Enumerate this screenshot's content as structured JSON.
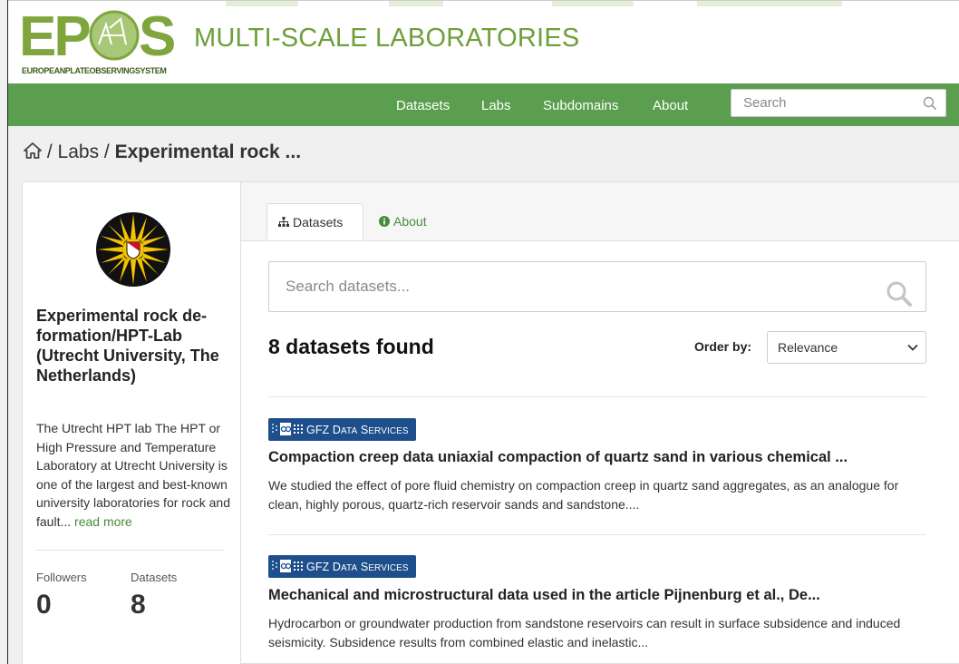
{
  "header": {
    "logo_word": "EPOS",
    "logo_tagline": "EUROPEANPLATEOBSERVINGSYSTEM",
    "site_title": "MULTI-SCALE LABORATORIES",
    "colors": {
      "brand_green": "#5c9e4f",
      "title_green": "#6f9e3a",
      "link_green": "#4a8a3b"
    }
  },
  "nav": {
    "items": [
      {
        "label": "Datasets"
      },
      {
        "label": "Labs"
      },
      {
        "label": "Subdomains"
      },
      {
        "label": "About"
      }
    ],
    "search": {
      "placeholder": "Search",
      "icon": "search-icon"
    }
  },
  "breadcrumb": {
    "home_icon": "home-icon",
    "sep": "/",
    "items": [
      "Labs",
      "Experimental rock ..."
    ]
  },
  "sidebar": {
    "org_title": "Experimental rock de-formation/HPT-Lab (Utrecht University, The Netherlands)",
    "org_description": "The Utrecht HPT lab The HPT or High Pressure and Temperature Laboratory at Utrecht University is one of the largest and best-known university laboratories for rock and fault...",
    "read_more": "read more",
    "stats": [
      {
        "label": "Followers",
        "value": "0"
      },
      {
        "label": "Datasets",
        "value": "8"
      }
    ]
  },
  "tabs": [
    {
      "label": "Datasets",
      "icon": "sitemap-icon",
      "active": true
    },
    {
      "label": "About",
      "icon": "info-circle-icon",
      "active": false
    }
  ],
  "dataset_search": {
    "placeholder": "Search datasets...",
    "icon": "search-icon"
  },
  "results": {
    "count_text": "8 datasets found",
    "order_label": "Order by:",
    "order_selected": "Relevance"
  },
  "badge": {
    "text_main": "GFZ D",
    "text_small1": "ATA",
    "text_mid": " S",
    "text_small2": "ERVICES",
    "color": "#1e4f8c"
  },
  "datasets": [
    {
      "title": "Compaction creep data uniaxial compaction of quartz sand in various chemical ...",
      "notes": "We studied the effect of pore fluid chemistry on compaction creep in quartz sand aggregates, as an analogue for clean, highly porous, quartz-rich reservoir sands and sandstone...."
    },
    {
      "title": "Mechanical and microstructural data used in the article Pijnenburg et al., De...",
      "notes": "Hydrocarbon or groundwater production from sandstone reservoirs can result in surface subsidence and induced seismicity. Subsidence results from combined elastic and inelastic..."
    }
  ]
}
